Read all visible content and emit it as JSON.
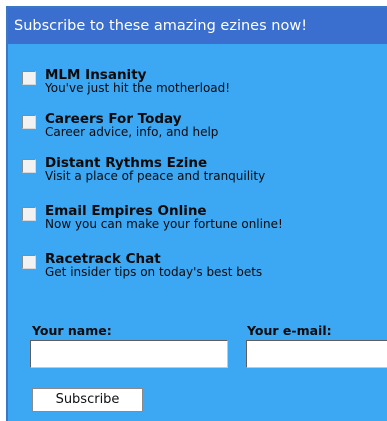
{
  "header": {
    "title": "Subscribe to these amazing ezines now!"
  },
  "ezines": [
    {
      "title": "MLM Insanity",
      "description": "You've just hit the motherload!"
    },
    {
      "title": "Careers For Today",
      "description": "Career advice, info, and help"
    },
    {
      "title": "Distant Rythms Ezine",
      "description": "Visit a place of peace and tranquility"
    },
    {
      "title": "Email Empires Online",
      "description": "Now you can make your fortune online!"
    },
    {
      "title": "Racetrack Chat",
      "description": "Get insider tips on today's best bets"
    }
  ],
  "form": {
    "name_label": "Your name:",
    "name_value": "",
    "email_label": "Your e-mail:",
    "email_value": "",
    "submit_label": "Subscribe"
  },
  "colors": {
    "panel_background": "#3ca7f2",
    "header_background": "#3a6fd0",
    "header_text": "#ffffff"
  }
}
